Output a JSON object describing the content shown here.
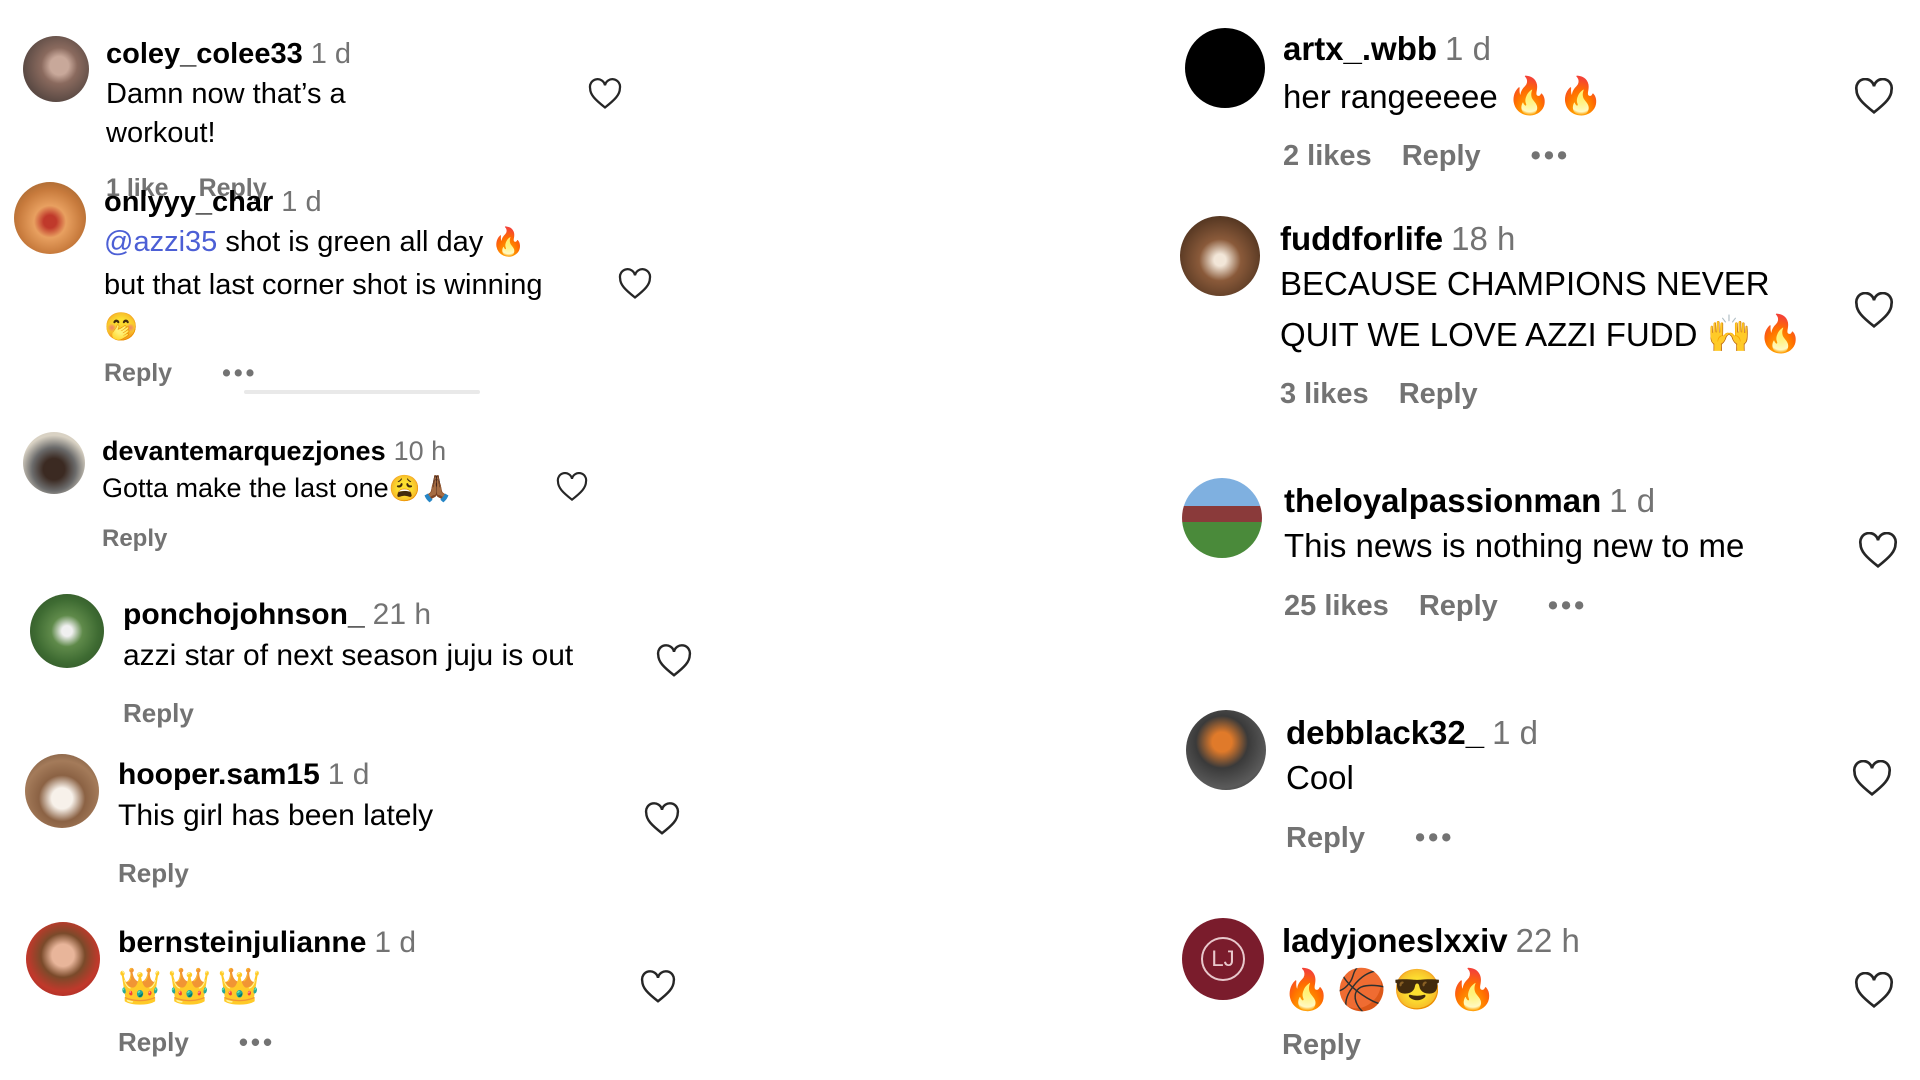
{
  "left": [
    {
      "user": "coley_colee33",
      "time": "1 d",
      "lines": [
        "Damn now that’s a workout!"
      ],
      "emoji_row": [],
      "likes": "1 like",
      "reply": "Reply",
      "more": ""
    },
    {
      "user": "onlyyy_char",
      "time": "1 d",
      "mention": "@azzi35",
      "lines": [
        " shot is green all day",
        "but that last corner shot is winning"
      ],
      "line1_emoji": "🔥",
      "emoji_row": [
        "🤭"
      ],
      "likes": "",
      "reply": "Reply",
      "more": "•••"
    },
    {
      "user": "devantemarquezjones",
      "time": "10 h",
      "lines": [
        "Gotta make the last one"
      ],
      "line_emojis": [
        "😩",
        "🙏🏾"
      ],
      "emoji_row": [],
      "likes": "",
      "reply": "Reply",
      "more": ""
    },
    {
      "user": "ponchojohnson_",
      "time": "21 h",
      "lines": [
        "azzi star of next season juju is out"
      ],
      "emoji_row": [],
      "likes": "",
      "reply": "Reply",
      "more": ""
    },
    {
      "user": "hooper.sam15",
      "time": "1 d",
      "lines": [
        "This girl has been lately"
      ],
      "emoji_row": [],
      "likes": "",
      "reply": "Reply",
      "more": ""
    },
    {
      "user": "bernsteinjulianne",
      "time": "1 d",
      "lines": [],
      "emoji_row": [
        "👑",
        "👑",
        "👑"
      ],
      "likes": "",
      "reply": "Reply",
      "more": "•••"
    }
  ],
  "right": [
    {
      "user": "artx_.wbb",
      "time": "1 d",
      "lines": [
        "her rangeeeee"
      ],
      "line_emojis": [
        "🔥",
        "🔥"
      ],
      "likes": "2 likes",
      "reply": "Reply",
      "more": "•••"
    },
    {
      "user": "fuddforlife",
      "time": "18 h",
      "lines": [
        "BECAUSE CHAMPIONS NEVER",
        "QUIT WE LOVE AZZI FUDD"
      ],
      "line_emojis": [
        "🙌",
        "🔥"
      ],
      "likes": "3 likes",
      "reply": "Reply",
      "more": ""
    },
    {
      "user": "theloyalpassionman",
      "time": "1 d",
      "lines": [
        "This news is nothing new to me"
      ],
      "likes": "25 likes",
      "reply": "Reply",
      "more": "•••"
    },
    {
      "user": "debblack32_",
      "time": "1 d",
      "lines": [
        "Cool"
      ],
      "likes": "",
      "reply": "Reply",
      "more": "•••"
    },
    {
      "user": "ladyjoneslxxiv",
      "time": "22 h",
      "lines": [],
      "emoji_row": [
        "🔥",
        "🏀",
        "😎",
        "🔥"
      ],
      "likes": "",
      "reply": "Reply",
      "more": "",
      "avatar_text": "LJ"
    }
  ],
  "colors": {
    "mention": "#4c5fd5",
    "muted": "#737373",
    "avatar_lj": "#7a1c2c"
  }
}
